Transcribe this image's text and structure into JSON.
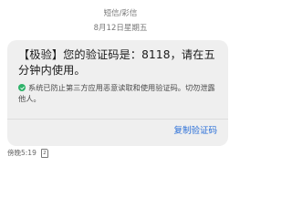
{
  "header": {
    "type_label": "短信/彩信",
    "date": "8月12日星期五"
  },
  "message": {
    "body": "【极验】您的验证码是：8118，请在五分钟内使用。",
    "security_note": "系统已防止第三方应用恶意读取和使用验证码。切勿泄露他人。",
    "security_icon": "shield-check-icon",
    "copy_button_label": "复制验证码"
  },
  "meta": {
    "time": "傍晚5:19",
    "sim_label": "2"
  },
  "colors": {
    "bubble_bg": "#efefef",
    "accent_blue": "#2a6fd8",
    "shield_green": "#2fb36a"
  }
}
